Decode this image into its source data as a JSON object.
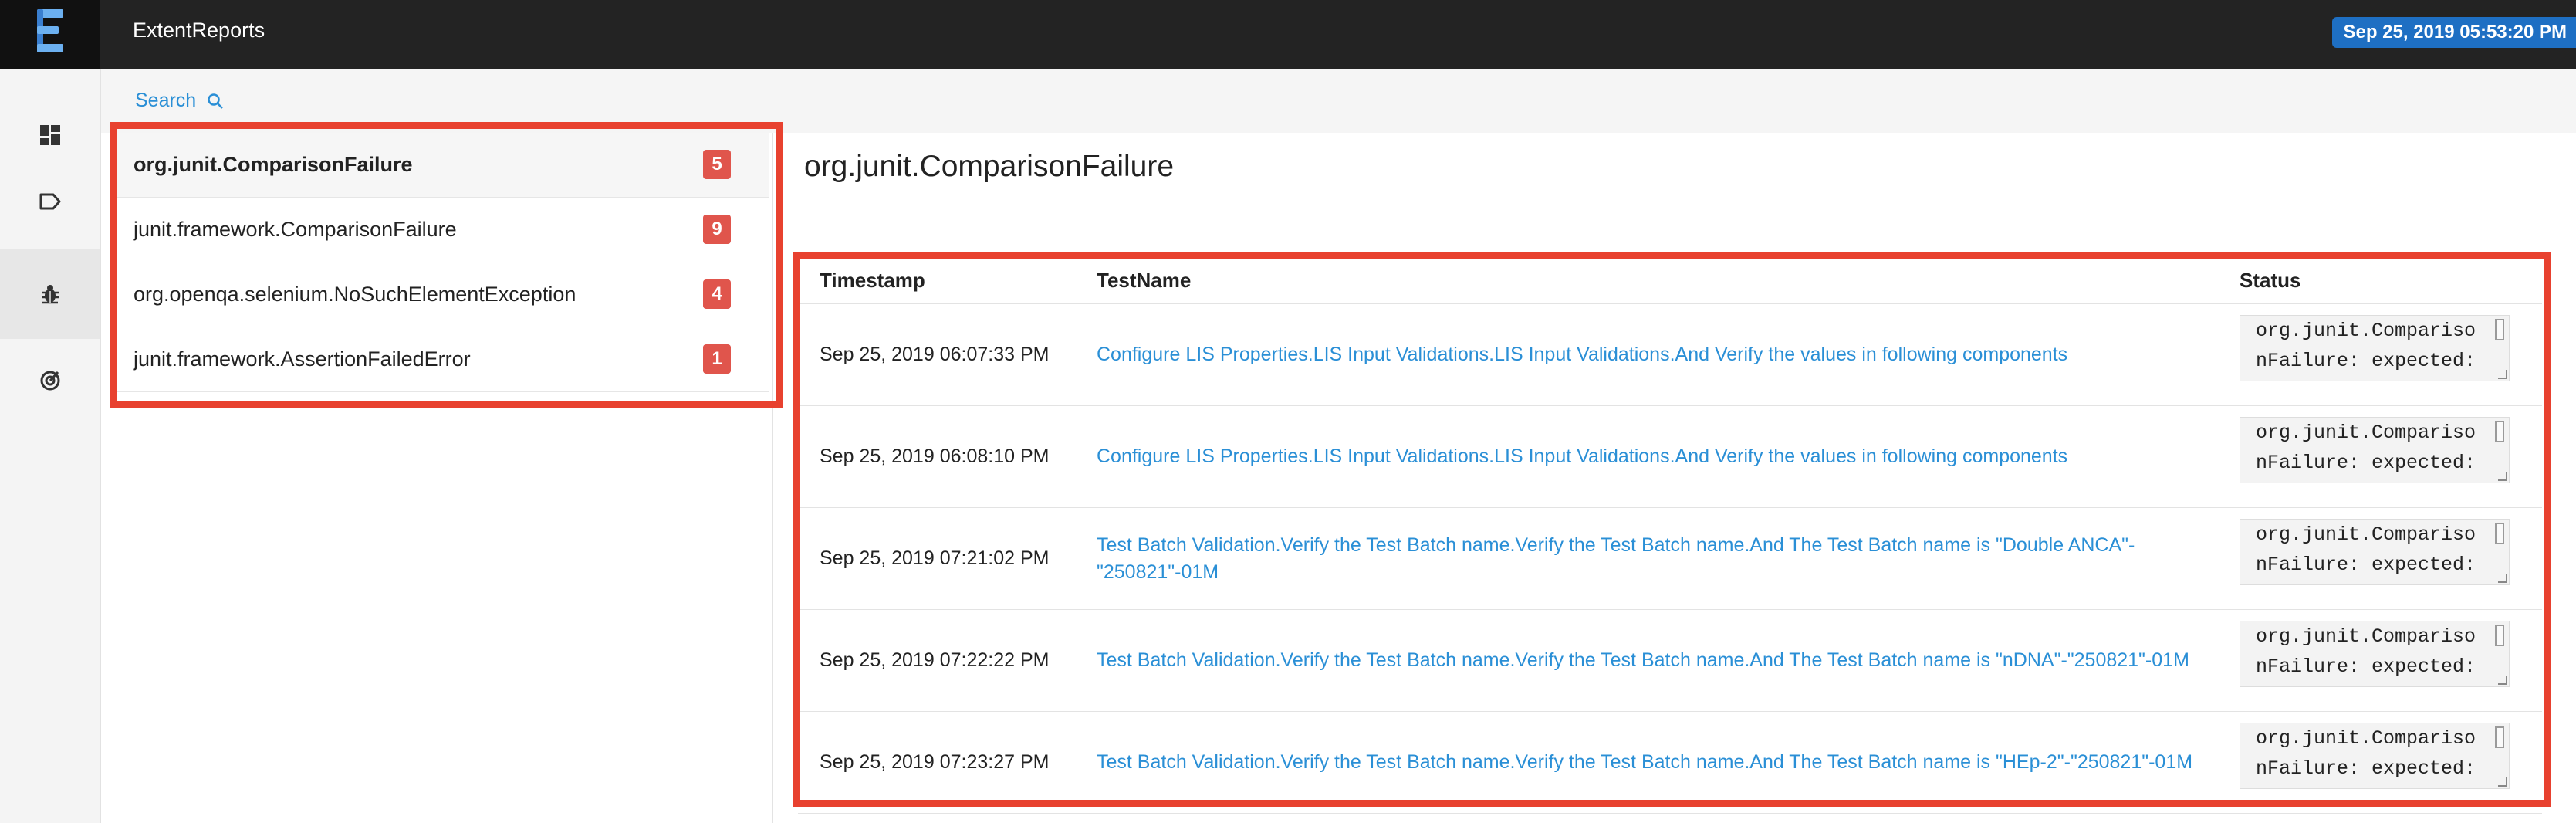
{
  "app": {
    "title": "ExtentReports",
    "date": "Sep 25, 2019 05:53:20 PM"
  },
  "nav": {
    "items": [
      {
        "icon": "dashboard-icon"
      },
      {
        "icon": "tag-icon"
      },
      {
        "icon": "bug-icon",
        "active": true
      },
      {
        "icon": "radar-icon"
      }
    ]
  },
  "search": {
    "label": "Search"
  },
  "exceptions": [
    {
      "name": "org.junit.ComparisonFailure",
      "count": "5"
    },
    {
      "name": "junit.framework.ComparisonFailure",
      "count": "9"
    },
    {
      "name": "org.openqa.selenium.NoSuchElementException",
      "count": "4"
    },
    {
      "name": "junit.framework.AssertionFailedError",
      "count": "1"
    }
  ],
  "detail": {
    "title": "org.junit.ComparisonFailure",
    "columns": {
      "timestamp": "Timestamp",
      "test_name": "TestName",
      "status": "Status"
    },
    "rows": [
      {
        "timestamp": "Sep 25, 2019 06:07:33 PM",
        "test_name": "Configure LIS Properties.LIS Input Validations.LIS Input Validations.And Verify the values in following components",
        "status_line1": "org.junit.Compariso",
        "status_line2": "nFailure: expected:"
      },
      {
        "timestamp": "Sep 25, 2019 06:08:10 PM",
        "test_name": "Configure LIS Properties.LIS Input Validations.LIS Input Validations.And Verify the values in following components",
        "status_line1": "org.junit.Compariso",
        "status_line2": "nFailure: expected:"
      },
      {
        "timestamp": "Sep 25, 2019 07:21:02 PM",
        "test_name": "Test Batch Validation.Verify the Test Batch name.Verify the Test Batch name.And The Test Batch name is \"Double ANCA\"-\"250821\"-01M",
        "status_line1": "org.junit.Compariso",
        "status_line2": "nFailure: expected:"
      },
      {
        "timestamp": "Sep 25, 2019 07:22:22 PM",
        "test_name": "Test Batch Validation.Verify the Test Batch name.Verify the Test Batch name.And The Test Batch name is \"nDNA\"-\"250821\"-01M",
        "status_line1": "org.junit.Compariso",
        "status_line2": "nFailure: expected:"
      },
      {
        "timestamp": "Sep 25, 2019 07:23:27 PM",
        "test_name": "Test Batch Validation.Verify the Test Batch name.Verify the Test Batch name.And The Test Batch name is \"HEp-2\"-\"250821\"-01M",
        "status_line1": "org.junit.Compariso",
        "status_line2": "nFailure: expected:"
      }
    ]
  },
  "colors": {
    "topbar": "#232323",
    "accent_blue": "#2a8fd6",
    "badge_red": "#e0554c",
    "annotation_red": "#e8412f"
  }
}
